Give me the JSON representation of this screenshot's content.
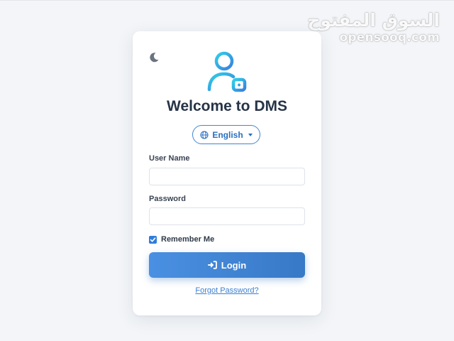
{
  "watermark": {
    "arabic": "السوق المفتوح",
    "latin": "opensooq.com"
  },
  "card": {
    "title": "Welcome to DMS",
    "theme_toggle_icon": "moon-icon",
    "logo_icon": "user-key-icon",
    "language": {
      "icon": "globe-icon",
      "selected": "English"
    },
    "username": {
      "label": "User Name",
      "value": "",
      "placeholder": ""
    },
    "password": {
      "label": "Password",
      "value": "",
      "placeholder": ""
    },
    "remember": {
      "label": "Remember Me",
      "checked": true
    },
    "login": {
      "label": "Login",
      "icon": "sign-in-icon"
    },
    "forgot_link": "Forgot Password?"
  },
  "colors": {
    "accent": "#3b82d6",
    "title": "#273447",
    "logo_gradient": [
      "#2fd0e8",
      "#3a7fe0"
    ]
  }
}
